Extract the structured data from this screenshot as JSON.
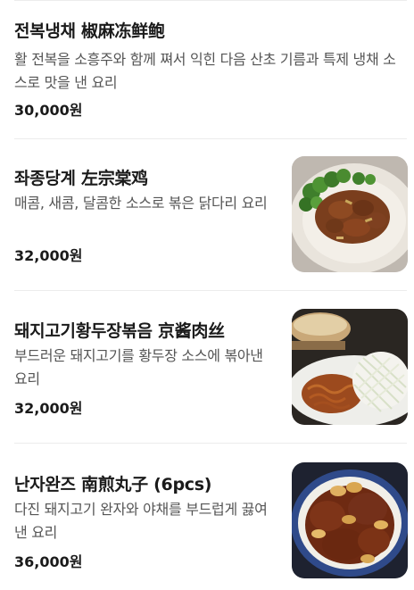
{
  "menu": {
    "items": [
      {
        "title": "전복냉채 椒麻冻鲜鲍",
        "description": "활 전복을 소흥주와 함께 쪄서 익힌 다음 산초 기름과 특제 냉채 소스로 맛을 낸 요리",
        "price": "30,000원"
      },
      {
        "title": "좌종당계 左宗棠鸡",
        "description": "매콤, 새콤, 달콤한 소스로 볶은 닭다리 요리",
        "price": "32,000원",
        "image": "general-tso-chicken-photo"
      },
      {
        "title": "돼지고기황두장볶음 京酱肉丝",
        "description": "부드러운 돼지고기를 황두장 소스에 볶아낸 요리",
        "price": "32,000원",
        "image": "jingjiang-pork-photo"
      },
      {
        "title": "난자완즈 南煎丸子 (6pcs)",
        "description": "다진 돼지고기 완자와 야채를 부드럽게 끓여낸 요리",
        "price": "36,000원",
        "image": "pork-meatballs-photo"
      }
    ]
  }
}
